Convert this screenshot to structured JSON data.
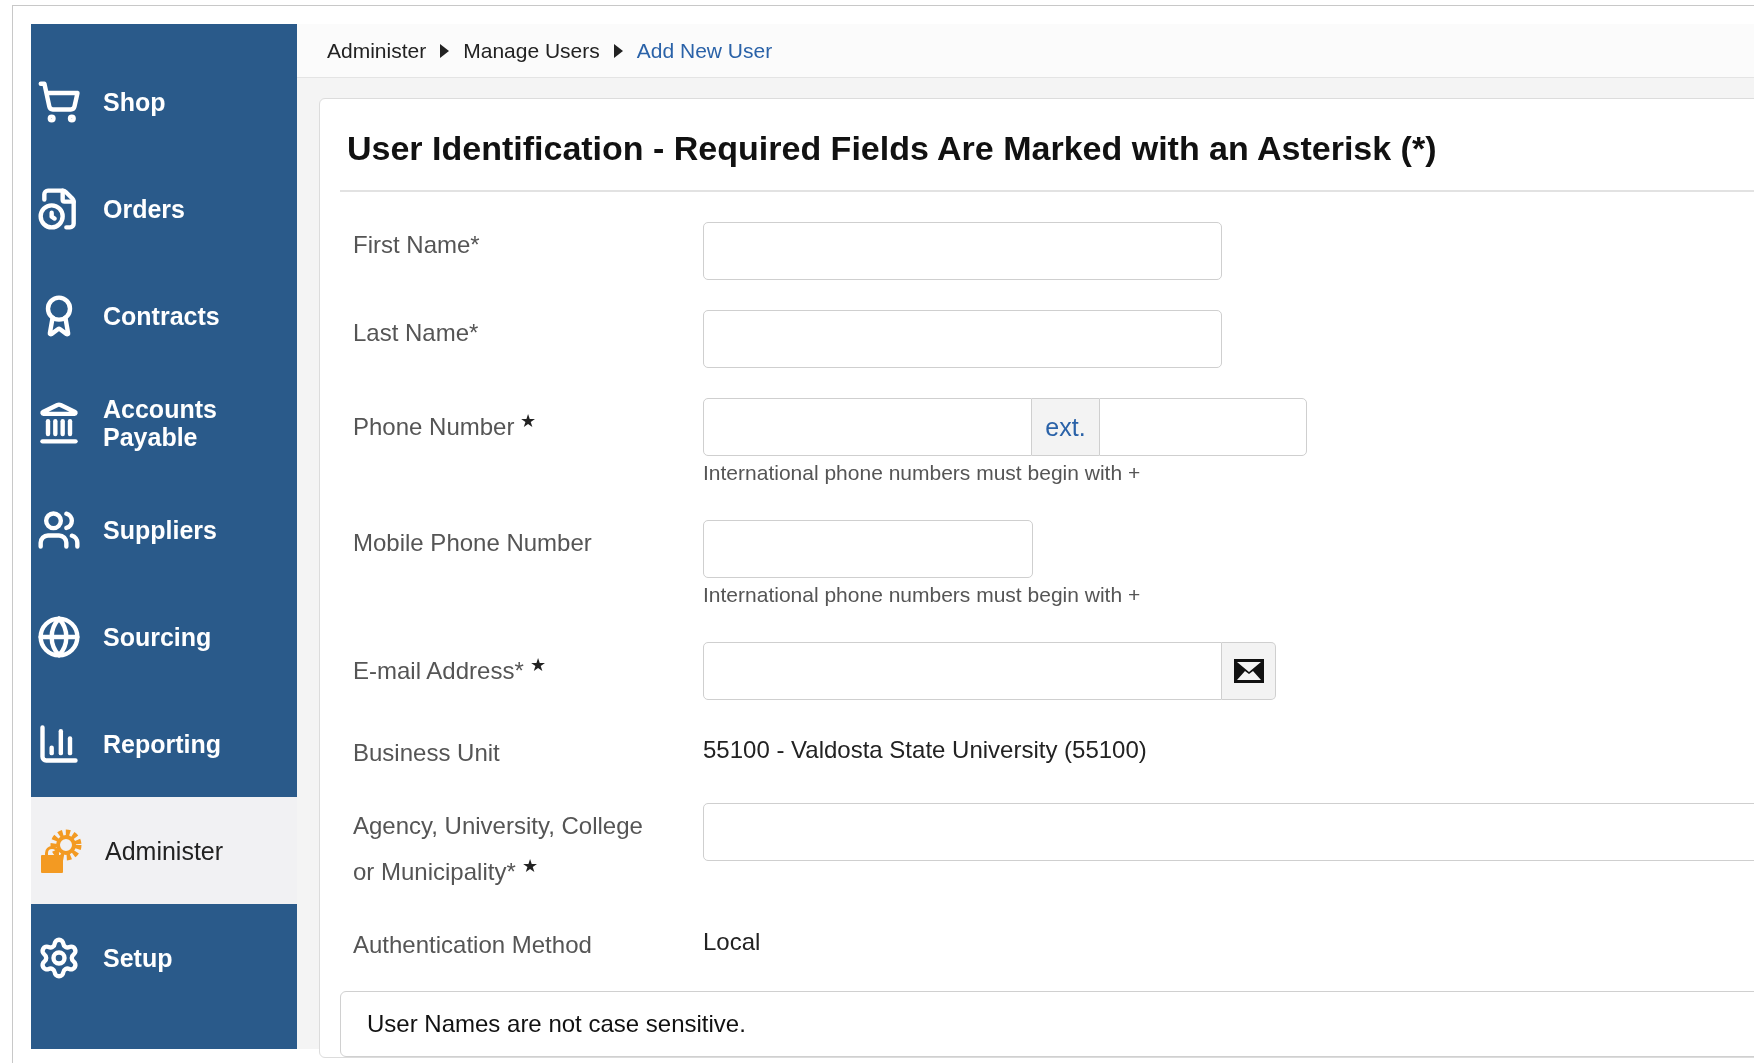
{
  "breadcrumb": [
    {
      "label": "Administer",
      "selected": false
    },
    {
      "label": "Manage Users",
      "selected": false
    },
    {
      "label": "Add New User",
      "selected": true
    }
  ],
  "sidebar": {
    "items": [
      {
        "label": "Shop",
        "selected": false
      },
      {
        "label": "Orders",
        "selected": false
      },
      {
        "label": "Contracts",
        "selected": false
      },
      {
        "label": "Accounts Payable",
        "selected": false
      },
      {
        "label": "Suppliers",
        "selected": false
      },
      {
        "label": "Sourcing",
        "selected": false
      },
      {
        "label": "Reporting",
        "selected": false
      },
      {
        "label": "Administer",
        "selected": true
      },
      {
        "label": "Setup",
        "selected": false
      }
    ]
  },
  "form": {
    "title": "User Identification - Required Fields Are Marked with an Asterisk (*)",
    "fields": [
      {
        "kind": "text",
        "label": "First Name*"
      },
      {
        "kind": "text",
        "label": "Last Name*"
      },
      {
        "kind": "phone",
        "label": "Phone Number",
        "star": "★",
        "addon": "ext.",
        "hint": "International phone numbers must begin with +"
      },
      {
        "kind": "short",
        "label": "Mobile Phone Number",
        "hint": "International phone numbers must begin with +"
      },
      {
        "kind": "email",
        "label": "E-mail Address*",
        "star": "★"
      },
      {
        "kind": "static",
        "label": "Business Unit",
        "value": "55100 - Valdosta State University (55100)"
      },
      {
        "kind": "wide",
        "label": "Agency, University, College or Municipality*",
        "star": "★"
      },
      {
        "kind": "static",
        "label": "Authentication Method",
        "value": "Local"
      }
    ],
    "note": "User Names are not case sensitive."
  }
}
